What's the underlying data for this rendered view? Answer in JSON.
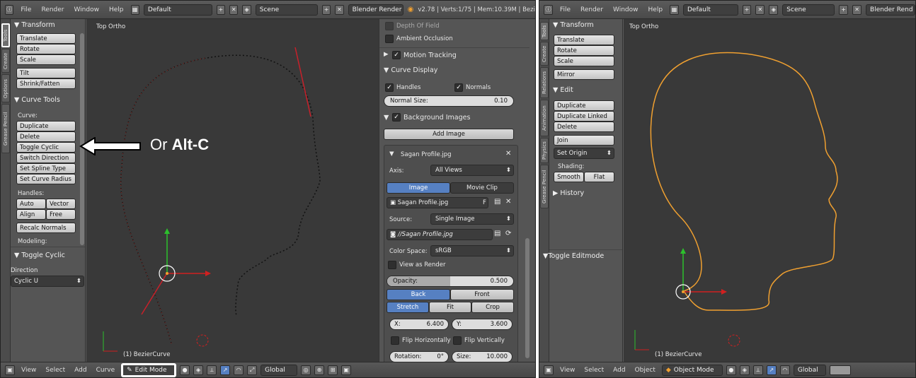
{
  "left": {
    "topbar": {
      "menus": [
        "File",
        "Render",
        "Window",
        "Help"
      ],
      "layout": "Default",
      "scene": "Scene",
      "engine": "Blender Render",
      "stats": "v2.78 | Verts:1/75 | Mem:10.39M | Bezi"
    },
    "tabs": [
      "Tools",
      "Create",
      "Options",
      "Grease Pencil"
    ],
    "tools": {
      "transform_title": "Transform",
      "translate": "Translate",
      "rotate": "Rotate",
      "scale": "Scale",
      "tilt": "Tilt",
      "shrink": "Shrink/Fatten",
      "curve_tools_title": "Curve Tools",
      "curve_label": "Curve:",
      "duplicate": "Duplicate",
      "delete": "Delete",
      "toggle_cyclic": "Toggle Cyclic",
      "switch_direction": "Switch Direction",
      "set_spline_type": "Set Spline Type",
      "set_curve_radius": "Set Curve Radius",
      "handles_label": "Handles:",
      "auto": "Auto",
      "vector": "Vector",
      "align": "Align",
      "free": "Free",
      "recalc": "Recalc Normals",
      "modeling_label": "Modeling:"
    },
    "operator": {
      "title": "Toggle Cyclic",
      "direction_label": "Direction",
      "direction_value": "Cyclic U"
    },
    "viewport": {
      "view_label": "Top Ortho",
      "object_label": "(1) BezierCurve",
      "annotation_prefix": "Or ",
      "annotation_key": "Alt-C"
    },
    "properties": {
      "depth_of_field": "Depth Of Field",
      "ambient_occlusion": "Ambient Occlusion",
      "motion_tracking": "Motion Tracking",
      "curve_display": "Curve Display",
      "handles": "Handles",
      "normals": "Normals",
      "normal_size_label": "Normal Size:",
      "normal_size_value": "0.10",
      "background_images": "Background Images",
      "add_image": "Add Image",
      "image_name": "Sagan Profile.jpg",
      "axis_label": "Axis:",
      "axis_value": "All Views",
      "tab_image": "Image",
      "tab_movie": "Movie Clip",
      "image_field": "Sagan Profile.jpg",
      "f_flag": "F",
      "source_label": "Source:",
      "source_value": "Single Image",
      "filepath": "//Sagan Profile.jpg",
      "color_space_label": "Color Space:",
      "color_space_value": "sRGB",
      "view_as_render": "View as Render",
      "opacity_label": "Opacity:",
      "opacity_value": "0.500",
      "opacity_fraction": 0.5,
      "back": "Back",
      "front": "Front",
      "stretch": "Stretch",
      "fit": "Fit",
      "crop": "Crop",
      "x_label": "X:",
      "x_value": "6.400",
      "y_label": "Y:",
      "y_value": "3.600",
      "flip_h": "Flip Horizontally",
      "flip_v": "Flip Vertically",
      "rotation_label": "Rotation:",
      "rotation_value": "0°",
      "size_label": "Size:",
      "size_value": "10.000"
    },
    "bottombar": {
      "view": "View",
      "select": "Select",
      "add": "Add",
      "curve": "Curve",
      "mode": "Edit Mode",
      "orientation": "Global"
    }
  },
  "right": {
    "topbar": {
      "menus": [
        "File",
        "Render",
        "Window",
        "Help"
      ],
      "layout": "Default",
      "scene": "Scene",
      "engine": "Blender Rend"
    },
    "tabs": [
      "Tools",
      "Create",
      "Relations",
      "Animation",
      "Physics",
      "Grease Pencil"
    ],
    "tools": {
      "transform_title": "Transform",
      "translate": "Translate",
      "rotate": "Rotate",
      "scale": "Scale",
      "mirror": "Mirror",
      "edit_title": "Edit",
      "duplicate": "Duplicate",
      "duplicate_linked": "Duplicate Linked",
      "delete": "Delete",
      "join": "Join",
      "set_origin": "Set Origin",
      "shading_label": "Shading:",
      "smooth": "Smooth",
      "flat": "Flat",
      "history": "History"
    },
    "operator_title": "Toggle Editmode",
    "viewport": {
      "view_label": "Top Ortho",
      "object_label": "(1) BezierCurve"
    },
    "bottombar": {
      "view": "View",
      "select": "Select",
      "add": "Add",
      "object": "Object",
      "mode": "Object Mode",
      "orientation": "Global"
    }
  },
  "colors": {
    "selected_blue": "#5680c2",
    "curve_orange": "#f0a030",
    "handle_red": "#c8202a",
    "annotation_white": "#ffffff"
  }
}
